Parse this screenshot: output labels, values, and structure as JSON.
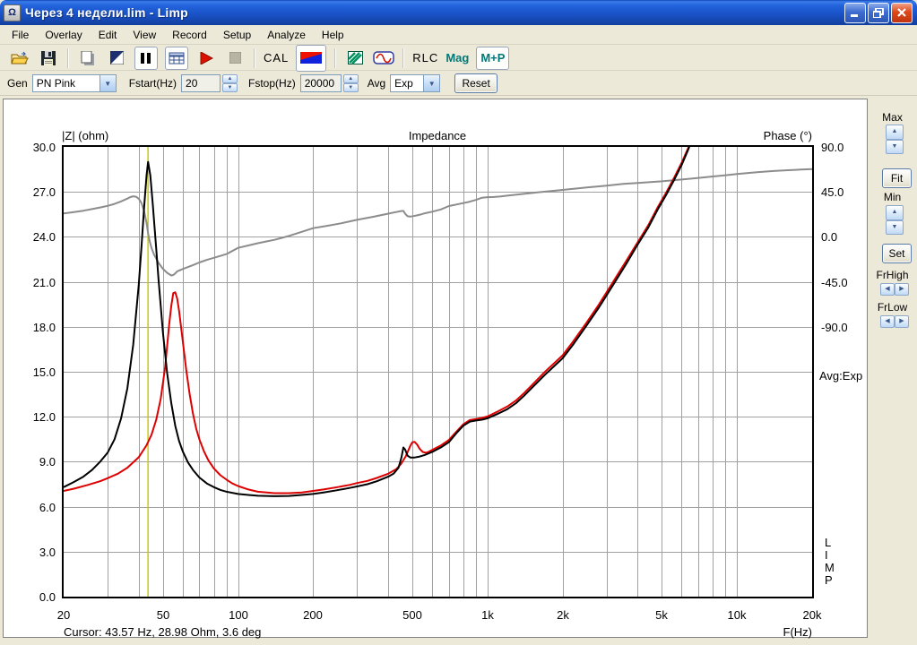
{
  "window": {
    "title": "Через 4 недели.lim - Limp"
  },
  "menu": [
    "File",
    "Overlay",
    "Edit",
    "View",
    "Record",
    "Setup",
    "Analyze",
    "Help"
  ],
  "toolbar": {
    "cal": "CAL",
    "rlc": "RLC",
    "mag": "Mag",
    "mp": "M+P"
  },
  "controls": {
    "gen_label": "Gen",
    "gen_value": "PN Pink",
    "fstart_label": "Fstart(Hz)",
    "fstart_value": "20",
    "fstop_label": "Fstop(Hz)",
    "fstop_value": "20000",
    "avg_label": "Avg",
    "avg_value": "Exp",
    "reset_label": "Reset"
  },
  "side_panel": {
    "max_label": "Max",
    "fit_label": "Fit",
    "min_label": "Min",
    "set_label": "Set",
    "frhigh_label": "FrHigh",
    "frlow_label": "FrLow"
  },
  "status": {
    "cursor": "Cursor: 43.57 Hz, 28.98 Ohm, 3.6 deg"
  },
  "chart_data": {
    "type": "line",
    "title": "Impedance",
    "y_left_label": "|Z| (ohm)",
    "y_right_label": "Phase (°)",
    "x_label": "F(Hz)",
    "avg_note": "Avg:Exp",
    "watermark": "LIMP",
    "x_scale": "log",
    "x_range": [
      20,
      20000
    ],
    "y_left_range": [
      0,
      30
    ],
    "y_right_range": [
      -90,
      90
    ],
    "y_right_degrees_per_row": 45,
    "grid": true,
    "grid_color": "#A0A0A0",
    "y_left_ticks": [
      "30.0",
      "27.0",
      "24.0",
      "21.0",
      "18.0",
      "15.0",
      "12.0",
      "9.0",
      "6.0",
      "3.0",
      "0.0"
    ],
    "y_right_ticks": [
      "90.0",
      "45.0",
      "0.0",
      "-45.0",
      "-90.0"
    ],
    "x_ticks": [
      {
        "f": 20,
        "label": "20"
      },
      {
        "f": 50,
        "label": "50"
      },
      {
        "f": 100,
        "label": "100"
      },
      {
        "f": 200,
        "label": "200"
      },
      {
        "f": 500,
        "label": "500"
      },
      {
        "f": 1000,
        "label": "1k"
      },
      {
        "f": 2000,
        "label": "2k"
      },
      {
        "f": 5000,
        "label": "5k"
      },
      {
        "f": 10000,
        "label": "10k"
      },
      {
        "f": 20000,
        "label": "20k"
      }
    ],
    "cursor": {
      "freq_hz": 43.57,
      "z_ohm": 28.98,
      "phase_deg": 3.6,
      "color": "#C8C400"
    },
    "series": [
      {
        "name": "impedance-current",
        "color": "#000000",
        "axis": "left",
        "points": [
          [
            20,
            7.3
          ],
          [
            22,
            7.65
          ],
          [
            24,
            8.0
          ],
          [
            26,
            8.45
          ],
          [
            28,
            9.0
          ],
          [
            30,
            9.6
          ],
          [
            32,
            10.5
          ],
          [
            34,
            11.9
          ],
          [
            36,
            13.9
          ],
          [
            38,
            16.8
          ],
          [
            40,
            20.8
          ],
          [
            41,
            23.3
          ],
          [
            42,
            25.9
          ],
          [
            43,
            28.1
          ],
          [
            43.6,
            29.0
          ],
          [
            44.5,
            28.1
          ],
          [
            45.5,
            26.2
          ],
          [
            47,
            23.2
          ],
          [
            48,
            21.2
          ],
          [
            50,
            17.6
          ],
          [
            52,
            14.9
          ],
          [
            54,
            12.9
          ],
          [
            56,
            11.4
          ],
          [
            58,
            10.4
          ],
          [
            60,
            9.7
          ],
          [
            63,
            8.95
          ],
          [
            66,
            8.45
          ],
          [
            70,
            7.95
          ],
          [
            75,
            7.55
          ],
          [
            80,
            7.3
          ],
          [
            85,
            7.12
          ],
          [
            90,
            7.0
          ],
          [
            100,
            6.85
          ],
          [
            110,
            6.78
          ],
          [
            120,
            6.73
          ],
          [
            140,
            6.7
          ],
          [
            160,
            6.72
          ],
          [
            180,
            6.78
          ],
          [
            200,
            6.85
          ],
          [
            220,
            6.95
          ],
          [
            250,
            7.1
          ],
          [
            280,
            7.25
          ],
          [
            300,
            7.35
          ],
          [
            330,
            7.5
          ],
          [
            360,
            7.7
          ],
          [
            400,
            8.0
          ],
          [
            420,
            8.2
          ],
          [
            440,
            8.6
          ],
          [
            452,
            9.3
          ],
          [
            460,
            9.95
          ],
          [
            468,
            9.8
          ],
          [
            478,
            9.4
          ],
          [
            490,
            9.28
          ],
          [
            510,
            9.28
          ],
          [
            530,
            9.33
          ],
          [
            560,
            9.45
          ],
          [
            600,
            9.65
          ],
          [
            650,
            9.95
          ],
          [
            700,
            10.3
          ],
          [
            750,
            10.9
          ],
          [
            800,
            11.4
          ],
          [
            850,
            11.68
          ],
          [
            900,
            11.75
          ],
          [
            950,
            11.8
          ],
          [
            1000,
            11.9
          ],
          [
            1100,
            12.2
          ],
          [
            1200,
            12.5
          ],
          [
            1300,
            12.9
          ],
          [
            1400,
            13.4
          ],
          [
            1500,
            13.9
          ],
          [
            1700,
            14.8
          ],
          [
            2000,
            15.9
          ],
          [
            2200,
            16.8
          ],
          [
            2500,
            18.1
          ],
          [
            2800,
            19.3
          ],
          [
            3000,
            20.1
          ],
          [
            3300,
            21.2
          ],
          [
            3600,
            22.2
          ],
          [
            4000,
            23.5
          ],
          [
            4400,
            24.6
          ],
          [
            4800,
            25.8
          ],
          [
            5200,
            26.8
          ],
          [
            5600,
            27.8
          ],
          [
            6000,
            28.8
          ],
          [
            6400,
            29.9
          ],
          [
            6600,
            30.6
          ]
        ]
      },
      {
        "name": "impedance-overlay",
        "color": "#DE0000",
        "axis": "left",
        "points": [
          [
            20,
            7.05
          ],
          [
            22,
            7.2
          ],
          [
            25,
            7.45
          ],
          [
            28,
            7.7
          ],
          [
            30,
            7.9
          ],
          [
            33,
            8.2
          ],
          [
            36,
            8.6
          ],
          [
            40,
            9.3
          ],
          [
            43,
            10.1
          ],
          [
            45,
            10.8
          ],
          [
            47,
            11.8
          ],
          [
            49,
            13.2
          ],
          [
            51,
            15.3
          ],
          [
            53,
            18.2
          ],
          [
            54,
            19.4
          ],
          [
            55,
            20.25
          ],
          [
            56,
            20.3
          ],
          [
            57,
            19.9
          ],
          [
            58,
            19.1
          ],
          [
            60,
            17.1
          ],
          [
            62,
            15.1
          ],
          [
            64,
            13.5
          ],
          [
            66,
            12.2
          ],
          [
            68,
            11.2
          ],
          [
            70,
            10.5
          ],
          [
            73,
            9.7
          ],
          [
            76,
            9.1
          ],
          [
            80,
            8.55
          ],
          [
            85,
            8.1
          ],
          [
            90,
            7.8
          ],
          [
            95,
            7.55
          ],
          [
            100,
            7.38
          ],
          [
            110,
            7.15
          ],
          [
            120,
            7.0
          ],
          [
            140,
            6.9
          ],
          [
            160,
            6.9
          ],
          [
            180,
            6.95
          ],
          [
            200,
            7.05
          ],
          [
            220,
            7.15
          ],
          [
            250,
            7.3
          ],
          [
            280,
            7.45
          ],
          [
            300,
            7.58
          ],
          [
            330,
            7.72
          ],
          [
            360,
            7.92
          ],
          [
            400,
            8.2
          ],
          [
            430,
            8.5
          ],
          [
            450,
            8.85
          ],
          [
            470,
            9.35
          ],
          [
            490,
            10.05
          ],
          [
            500,
            10.3
          ],
          [
            510,
            10.32
          ],
          [
            522,
            10.15
          ],
          [
            535,
            9.85
          ],
          [
            550,
            9.65
          ],
          [
            565,
            9.6
          ],
          [
            580,
            9.65
          ],
          [
            600,
            9.78
          ],
          [
            650,
            10.08
          ],
          [
            700,
            10.45
          ],
          [
            750,
            11.0
          ],
          [
            800,
            11.5
          ],
          [
            850,
            11.78
          ],
          [
            900,
            11.85
          ],
          [
            950,
            11.92
          ],
          [
            1000,
            12.02
          ],
          [
            1100,
            12.35
          ],
          [
            1200,
            12.68
          ],
          [
            1300,
            13.08
          ],
          [
            1400,
            13.58
          ],
          [
            1500,
            14.08
          ],
          [
            1700,
            15.0
          ],
          [
            2000,
            16.1
          ],
          [
            2200,
            17.0
          ],
          [
            2500,
            18.3
          ],
          [
            2800,
            19.5
          ],
          [
            3000,
            20.3
          ],
          [
            3300,
            21.4
          ],
          [
            3600,
            22.4
          ],
          [
            4000,
            23.65
          ],
          [
            4400,
            24.75
          ],
          [
            4800,
            25.95
          ],
          [
            5200,
            26.95
          ],
          [
            5600,
            27.95
          ],
          [
            6000,
            28.95
          ],
          [
            6400,
            30.0
          ],
          [
            6600,
            30.6
          ]
        ]
      },
      {
        "name": "phase",
        "color": "#8C8C8C",
        "axis": "right",
        "points": [
          [
            20,
            23.5
          ],
          [
            22,
            24.8
          ],
          [
            24,
            26.2
          ],
          [
            26,
            27.8
          ],
          [
            28,
            29.4
          ],
          [
            30,
            31.0
          ],
          [
            32,
            33.0
          ],
          [
            34,
            35.5
          ],
          [
            36,
            38.3
          ],
          [
            37,
            39.8
          ],
          [
            38,
            40.6
          ],
          [
            39,
            40.2
          ],
          [
            40,
            38.2
          ],
          [
            41,
            34.0
          ],
          [
            42,
            26.0
          ],
          [
            43,
            14.0
          ],
          [
            43.6,
            3.6
          ],
          [
            44.2,
            -4.0
          ],
          [
            45,
            -11.0
          ],
          [
            46,
            -17.5
          ],
          [
            48,
            -26.0
          ],
          [
            50,
            -32.0
          ],
          [
            52,
            -36.0
          ],
          [
            54,
            -38.6
          ],
          [
            55,
            -38.2
          ],
          [
            56,
            -36.6
          ],
          [
            57,
            -34.5
          ],
          [
            58,
            -33.8
          ],
          [
            59,
            -33.0
          ],
          [
            60,
            -32.2
          ],
          [
            63,
            -30.2
          ],
          [
            66,
            -28.2
          ],
          [
            70,
            -25.6
          ],
          [
            75,
            -23.0
          ],
          [
            80,
            -21.0
          ],
          [
            90,
            -17.2
          ],
          [
            100,
            -11.0
          ],
          [
            110,
            -8.6
          ],
          [
            120,
            -6.4
          ],
          [
            130,
            -4.6
          ],
          [
            140,
            -3.0
          ],
          [
            150,
            -1.0
          ],
          [
            160,
            1.0
          ],
          [
            180,
            5.0
          ],
          [
            200,
            8.7
          ],
          [
            230,
            11.2
          ],
          [
            260,
            13.6
          ],
          [
            300,
            17.0
          ],
          [
            350,
            20.2
          ],
          [
            400,
            23.2
          ],
          [
            430,
            24.8
          ],
          [
            450,
            25.8
          ],
          [
            460,
            26.0
          ],
          [
            468,
            23.0
          ],
          [
            478,
            20.6
          ],
          [
            490,
            20.3
          ],
          [
            505,
            20.8
          ],
          [
            520,
            21.4
          ],
          [
            540,
            22.4
          ],
          [
            560,
            23.6
          ],
          [
            600,
            25.2
          ],
          [
            650,
            27.4
          ],
          [
            700,
            30.8
          ],
          [
            750,
            32.4
          ],
          [
            800,
            33.8
          ],
          [
            850,
            35.2
          ],
          [
            900,
            37.0
          ],
          [
            950,
            39.2
          ],
          [
            1000,
            39.7
          ],
          [
            1060,
            39.9
          ],
          [
            1120,
            40.3
          ],
          [
            1200,
            41.2
          ],
          [
            1400,
            43.0
          ],
          [
            1600,
            44.6
          ],
          [
            1800,
            45.9
          ],
          [
            2000,
            47.0
          ],
          [
            2500,
            49.4
          ],
          [
            3000,
            51.3
          ],
          [
            3500,
            53.0
          ],
          [
            4000,
            54.0
          ],
          [
            4500,
            54.8
          ],
          [
            5000,
            55.6
          ],
          [
            6000,
            57.4
          ],
          [
            7000,
            59.0
          ],
          [
            8000,
            60.4
          ],
          [
            9000,
            61.7
          ],
          [
            10000,
            62.8
          ],
          [
            12000,
            64.6
          ],
          [
            14000,
            65.9
          ],
          [
            16000,
            66.7
          ],
          [
            18000,
            67.3
          ],
          [
            20000,
            67.8
          ]
        ]
      }
    ]
  }
}
